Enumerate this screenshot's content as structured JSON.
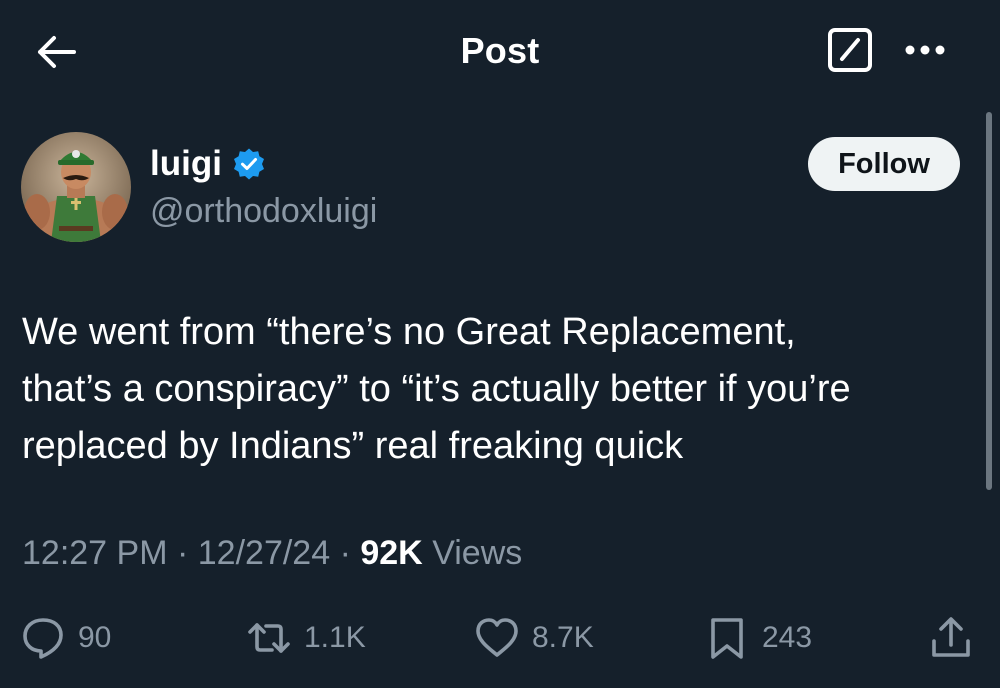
{
  "header": {
    "title": "Post"
  },
  "author": {
    "name": "luigi",
    "handle": "@orthodoxluigi",
    "verified": true
  },
  "follow_button": {
    "label": "Follow"
  },
  "post": {
    "lines": [
      "We went from “there’s no Great Replacement,",
      "that’s a conspiracy” to “it’s actually better if you’re",
      "replaced by Indians” real freaking quick"
    ]
  },
  "meta": {
    "time": "12:27 PM",
    "separator": "·",
    "date": "12/27/24",
    "views_count": "92K",
    "views_label": "Views"
  },
  "actions": {
    "replies": "90",
    "reposts": "1.1K",
    "likes": "8.7K",
    "bookmarks": "243"
  },
  "colors": {
    "background": "#15202b",
    "text_primary": "#ffffff",
    "text_secondary": "#8b98a5",
    "verified_blue": "#1d9bf0",
    "follow_bg": "#eff3f4"
  },
  "icons": {
    "back": "arrow-left-icon",
    "grok": "grok-icon",
    "more": "more-horizontal-icon",
    "verified": "verified-badge-icon",
    "reply": "reply-icon",
    "repost": "repost-icon",
    "like": "heart-icon",
    "bookmark": "bookmark-icon",
    "share": "share-icon"
  }
}
